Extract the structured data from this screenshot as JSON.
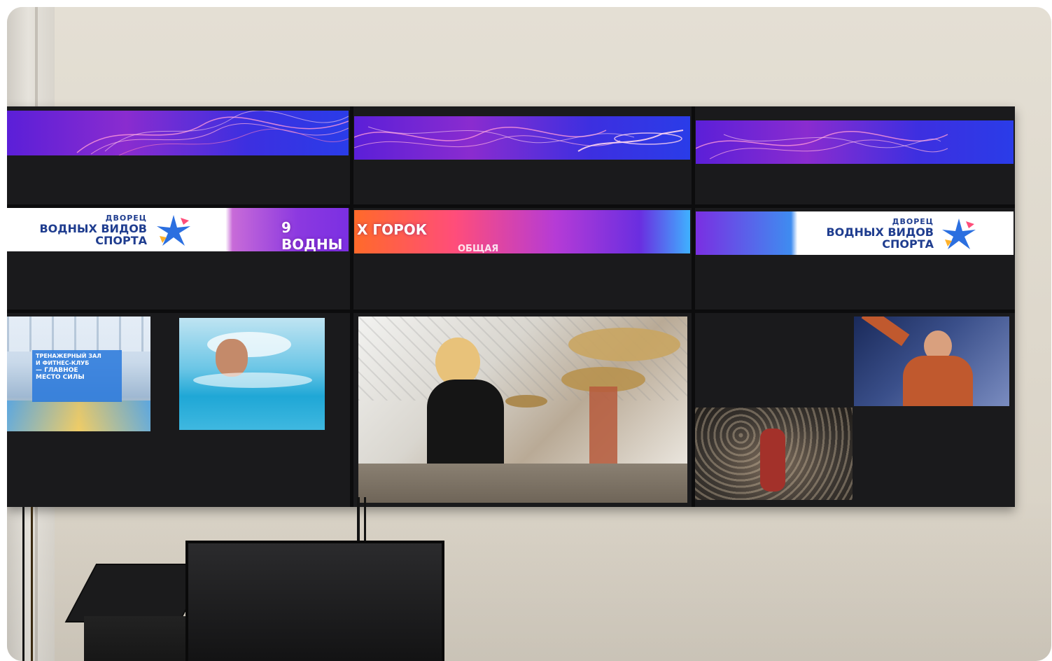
{
  "scene": {
    "description_label": "Videowall",
    "logo": {
      "line1": "ДВОРЕЦ",
      "line2": "ВОДНЫХ ВИДОВ",
      "line3": "СПОРТА"
    },
    "banner_center": {
      "title": "9 ВОДНЫ",
      "title_cont": "Х ГОРОК",
      "sub": "ОБЩАЯ"
    },
    "gym_caption": {
      "line1": "ТРЕНАЖЕРНЫЙ ЗАЛ",
      "line2": "И ФИТНЕС-КЛУБ",
      "line3": "— ГЛАВНОЕ",
      "line4": "МЕСТО СИЛЫ"
    }
  },
  "colors": {
    "wall": "#e0dbd0",
    "bezel": "#0c0c0d",
    "brand_blue": "#1f3d8f",
    "wave_purple": "#6a2ee0"
  }
}
